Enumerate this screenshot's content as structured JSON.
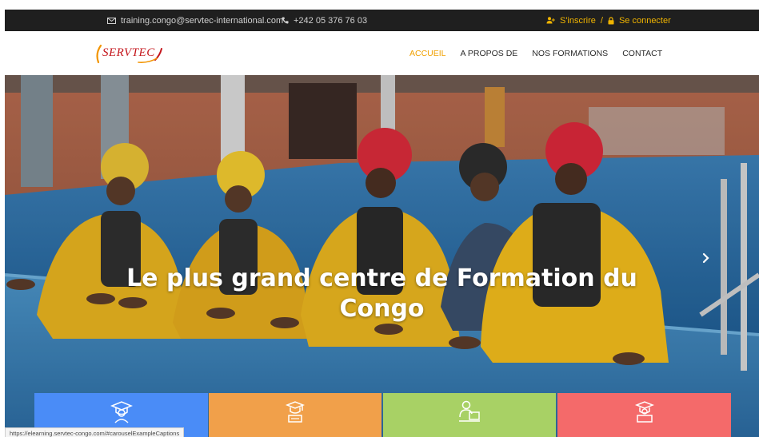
{
  "topbar": {
    "email": "training.congo@servtec-international.com",
    "phone": "+242 05 376 76 03",
    "signup_label": "S'inscrire",
    "separator": "/",
    "login_label": "Se connecter",
    "icons": {
      "email": "envelope-icon",
      "phone": "phone-icon",
      "signup": "user-plus-icon",
      "login": "lock-icon"
    },
    "accent_color": "#f0b400"
  },
  "logo": {
    "text": "SERVTEC"
  },
  "nav": {
    "items": [
      {
        "label": "ACCUEIL",
        "active": true
      },
      {
        "label": "A PROPOS DE",
        "active": false
      },
      {
        "label": "NOS FORMATIONS",
        "active": false
      },
      {
        "label": "CONTACT",
        "active": false
      }
    ],
    "active_color": "#f0a000"
  },
  "hero": {
    "caption_line1": "Le plus grand centre de Formation du",
    "caption_line2": "Congo",
    "next_arrow": "›"
  },
  "tiles": [
    {
      "icon": "graduate-icon",
      "color": "#4a8cf7"
    },
    {
      "icon": "diploma-icon",
      "color": "#f1a04a"
    },
    {
      "icon": "elearning-icon",
      "color": "#a8d165"
    },
    {
      "icon": "certificate-icon",
      "color": "#f46a6a"
    }
  ],
  "statusbar": {
    "url": "https://elearning.servtec-congo.com/#carouselExampleCaptions"
  }
}
